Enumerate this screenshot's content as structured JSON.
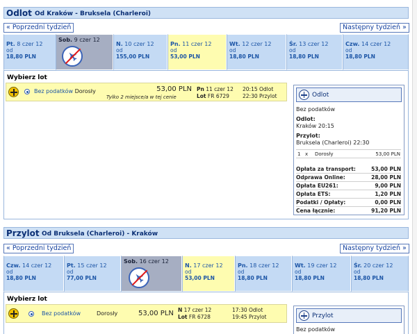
{
  "outbound": {
    "title": "Odlot",
    "route": "Od Kraków - Bruksela (Charleroi)",
    "prev_week": "« Poprzedni tydzień",
    "next_week": "Następny tydzień »",
    "days": [
      {
        "name_bold": "Pt.",
        "name": "8 czer 12",
        "from": "od",
        "price": "18,80 PLN",
        "state": "normal"
      },
      {
        "name_bold": "Sob.",
        "name": "9 czer 12",
        "from": "",
        "price": "",
        "state": "disabled"
      },
      {
        "name_bold": "N.",
        "name": "10 czer 12",
        "from": "od",
        "price": "155,00 PLN",
        "state": "normal"
      },
      {
        "name_bold": "Pn.",
        "name": "11 czer 12",
        "from": "od",
        "price": "53,00 PLN",
        "state": "selected"
      },
      {
        "name_bold": "Wt.",
        "name": "12 czer 12",
        "from": "od",
        "price": "18,80 PLN",
        "state": "normal"
      },
      {
        "name_bold": "Śr.",
        "name": "13 czer 12",
        "from": "od",
        "price": "18,80 PLN",
        "state": "normal"
      },
      {
        "name_bold": "Czw.",
        "name": "14 czer 12",
        "from": "od",
        "price": "18,80 PLN",
        "state": "normal"
      }
    ],
    "choose_label": "Wybierz lot",
    "flight": {
      "fare": "Bez podatków",
      "passenger": "Dorosły",
      "price": "53,00 PLN",
      "seats_note": "Tylko 2 miejsce/a w tej cenie",
      "date_day": "Pn",
      "date": "11 czer 12",
      "flight_label": "Lot",
      "flight_no": "FR 6729",
      "dep_time": "20:15",
      "dep_label": "Odlot",
      "arr_time": "22:30",
      "arr_label": "Przylot"
    },
    "summary": {
      "header": "Odlot",
      "fare": "Bez podatków",
      "dep_title": "Odlot:",
      "dep_value": "Kraków 20:15",
      "arr_title": "Przylot:",
      "arr_value": "Bruksela (Charleroi) 22:30",
      "pax_count": "1",
      "pax_x": "x",
      "pax_type": "Dorosły",
      "pax_price": "53,00 PLN",
      "fees": [
        {
          "label": "Opłata za transport:",
          "value": "53,00 PLN"
        },
        {
          "label": "Odprawa Online:",
          "value": "28,00 PLN"
        },
        {
          "label": "Opłata EU261:",
          "value": "9,00 PLN"
        },
        {
          "label": "Opłata ETS:",
          "value": "1,20 PLN"
        },
        {
          "label": "Podatki / Opłaty:",
          "value": "0,00 PLN"
        },
        {
          "label": "Cena łącznie:",
          "value": "91,20 PLN"
        }
      ]
    }
  },
  "inbound": {
    "title": "Przylot",
    "route": "Od Bruksela (Charleroi) - Kraków",
    "prev_week": "« Poprzedni tydzień",
    "next_week": "Następny tydzień »",
    "days": [
      {
        "name_bold": "Czw.",
        "name": "14 czer 12",
        "from": "od",
        "price": "18,80 PLN",
        "state": "normal"
      },
      {
        "name_bold": "Pt.",
        "name": "15 czer 12",
        "from": "od",
        "price": "77,00 PLN",
        "state": "normal"
      },
      {
        "name_bold": "Sob.",
        "name": "16 czer 12",
        "from": "",
        "price": "",
        "state": "disabled"
      },
      {
        "name_bold": "N.",
        "name": "17 czer 12",
        "from": "od",
        "price": "53,00 PLN",
        "state": "selected"
      },
      {
        "name_bold": "Pn.",
        "name": "18 czer 12",
        "from": "od",
        "price": "18,80 PLN",
        "state": "normal"
      },
      {
        "name_bold": "Wt.",
        "name": "19 czer 12",
        "from": "od",
        "price": "18,80 PLN",
        "state": "normal"
      },
      {
        "name_bold": "Śr.",
        "name": "20 czer 12",
        "from": "od",
        "price": "18,80 PLN",
        "state": "normal"
      }
    ],
    "choose_label": "Wybierz lot",
    "flight": {
      "fare": "Bez podatków",
      "passenger": "Dorosły",
      "price": "53,00 PLN",
      "date_day": "N",
      "date": "17 czer 12",
      "flight_label": "Lot",
      "flight_no": "FR 6728",
      "dep_time": "17:30",
      "dep_label": "Odlot",
      "arr_time": "19:45",
      "arr_label": "Przylot"
    },
    "summary": {
      "header": "Przylot",
      "fare": "Bez podatków"
    }
  }
}
